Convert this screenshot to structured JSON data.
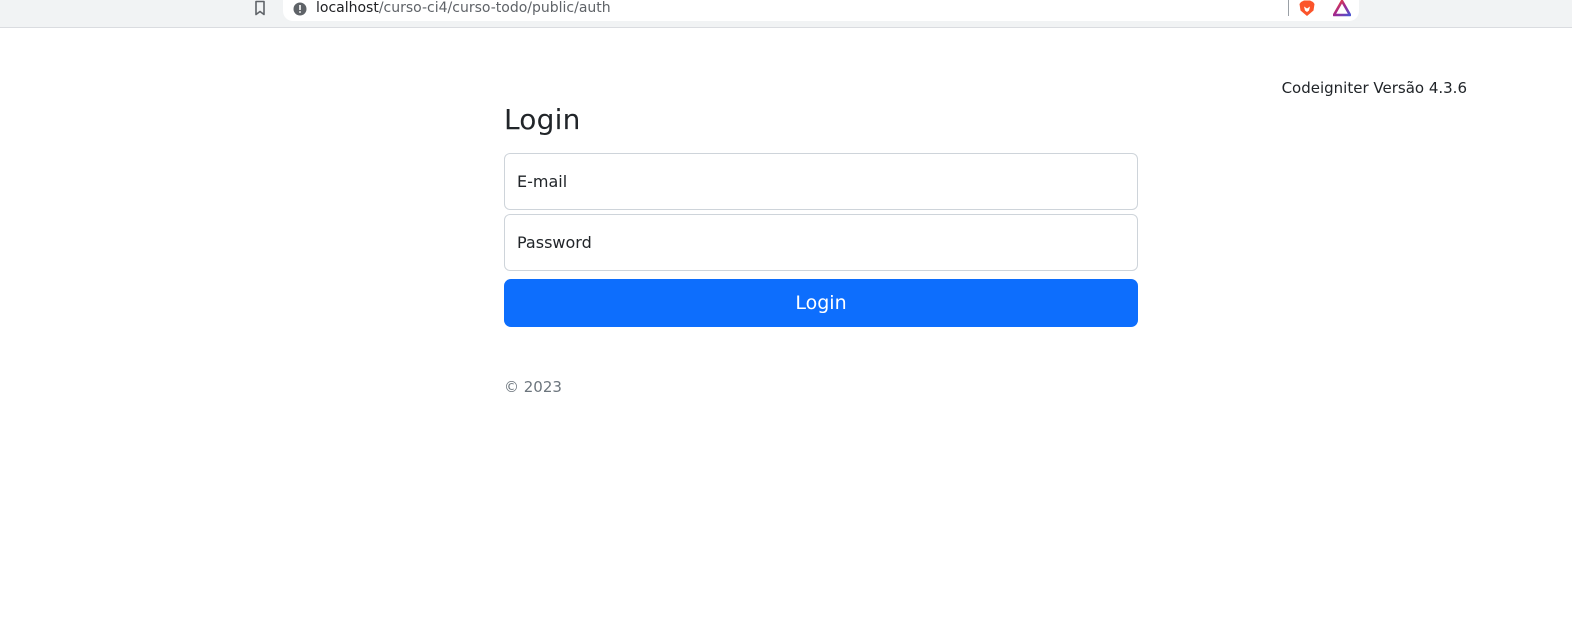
{
  "browser": {
    "url_host": "localhost",
    "url_path": "/curso-ci4/curso-todo/public/auth"
  },
  "header": {
    "version_text": "Codeigniter Versão 4.3.6"
  },
  "login_form": {
    "title": "Login",
    "email_label": "E-mail",
    "password_label": "Password",
    "submit_label": "Login"
  },
  "footer": {
    "copyright": "© 2023"
  },
  "colors": {
    "primary": "#0d6efd",
    "input_border": "#ced4da",
    "muted_text": "#6c757d"
  },
  "icons": {
    "bookmark": "bookmark-icon",
    "info": "info-icon",
    "brave": "brave-shields-icon",
    "rewards": "brave-rewards-icon"
  }
}
